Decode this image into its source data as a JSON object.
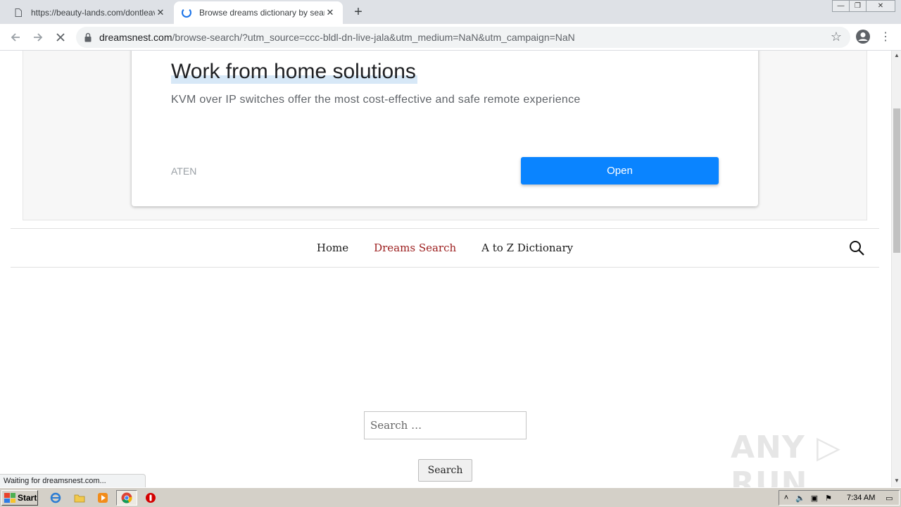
{
  "browser": {
    "tabs": [
      {
        "title": "https://beauty-lands.com/dontleave",
        "active": false
      },
      {
        "title": "Browse dreams dictionary by search",
        "active": true
      }
    ],
    "new_tab_symbol": "+",
    "window_controls": {
      "minimize": "—",
      "restore": "❐",
      "close": "✕"
    },
    "url_host": "dreamsnest.com",
    "url_path": "/browse-search/?utm_source=ccc-bldl-dn-live-jala&utm_medium=NaN&utm_campaign=NaN",
    "status_text": "Waiting for dreamsnest.com..."
  },
  "ad": {
    "title": "Work from home solutions",
    "description": "KVM over IP switches offer the most cost-effective and safe remote experience",
    "brand": "ATEN",
    "cta": "Open"
  },
  "site_nav": {
    "items": [
      {
        "label": "Home",
        "current": false
      },
      {
        "label": "Dreams Search",
        "current": true
      },
      {
        "label": "A to Z Dictionary",
        "current": false
      }
    ]
  },
  "search": {
    "placeholder": "Search …",
    "button": "Search"
  },
  "watermark": "ANY ▷ RUN",
  "taskbar": {
    "start_label": "Start",
    "clock": "7:34 AM"
  },
  "colors": {
    "accent_blue": "#0a84ff",
    "nav_current": "#9b1c1c",
    "tab_strip": "#dee1e6"
  }
}
